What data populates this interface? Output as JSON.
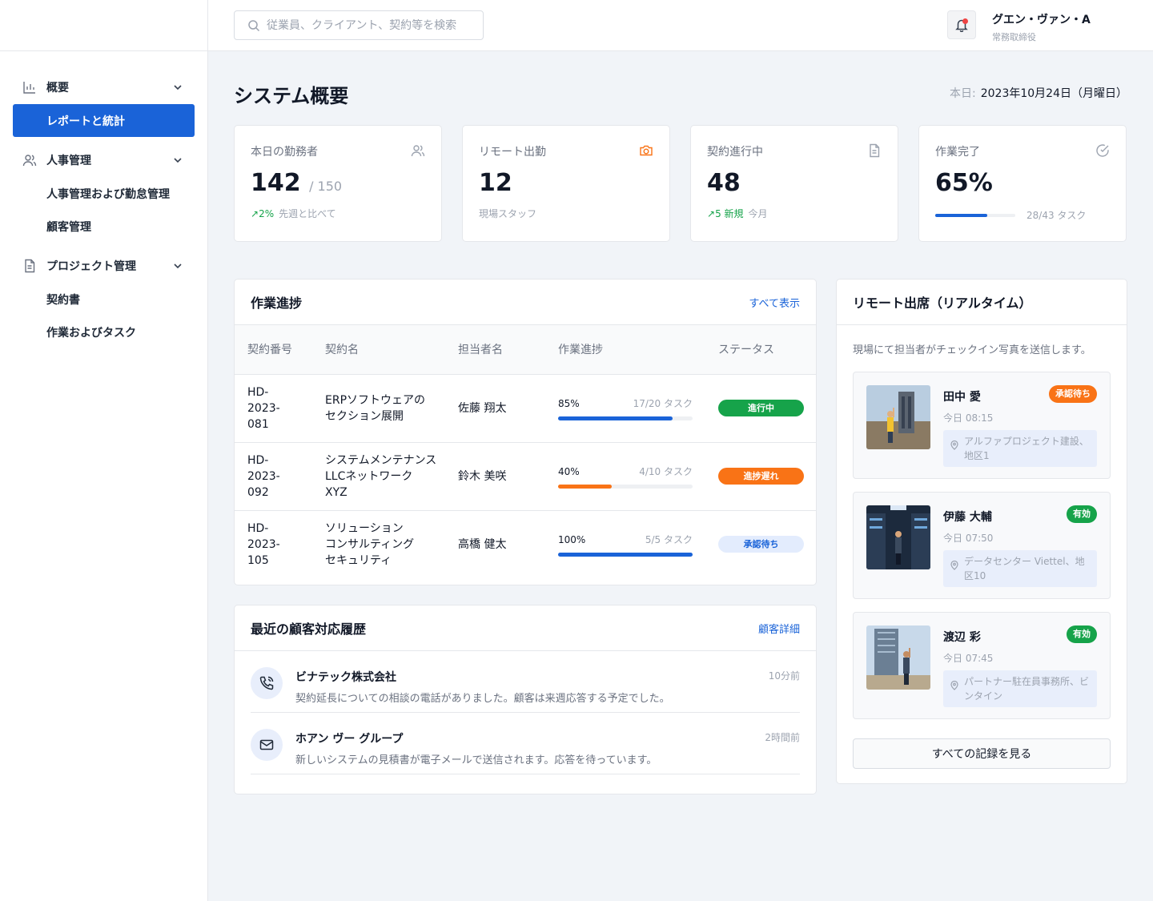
{
  "search": {
    "placeholder": "従業員、クライアント、契約等を検索"
  },
  "user": {
    "name": "グエン・ヴァン・A",
    "role": "常務取締役"
  },
  "sidebar": {
    "groups": [
      {
        "label": "概要",
        "icon": "bar-chart-icon",
        "items": [
          {
            "label": "レポートと統計",
            "active": true
          }
        ]
      },
      {
        "label": "人事管理",
        "icon": "users-icon",
        "items": [
          {
            "label": "人事管理および勤怠管理"
          },
          {
            "label": "顧客管理"
          }
        ]
      },
      {
        "label": "プロジェクト管理",
        "icon": "document-icon",
        "items": [
          {
            "label": "契約書"
          },
          {
            "label": "作業およびタスク"
          }
        ]
      }
    ]
  },
  "page": {
    "title": "システム概要",
    "today_label": "本日:",
    "today_value": "2023年10月24日（月曜日）"
  },
  "stats": [
    {
      "label": "本日の勤務者",
      "icon": "users-icon",
      "value": "142",
      "of": "/ 150",
      "trend": "2%",
      "foot": "先週と比べて"
    },
    {
      "label": "リモート出勤",
      "icon": "camera-icon",
      "value": "12",
      "foot": "現場スタッフ"
    },
    {
      "label": "契約進行中",
      "icon": "document-icon",
      "value": "48",
      "trend": "5 新規",
      "foot": "今月"
    },
    {
      "label": "作業完了",
      "icon": "check-circle-icon",
      "value": "65%",
      "progress": 0.65,
      "foot": "28/43 タスク"
    }
  ],
  "work_progress": {
    "title": "作業進捗",
    "link": "すべて表示",
    "headers": [
      "契約番号",
      "契約名",
      "担当者名",
      "作業進捗",
      "ステータス"
    ],
    "rows": [
      {
        "id": "HD-\n2023-\n081",
        "name": "ERPソフトウェアの\nセクション展開",
        "owner": "佐藤 翔太",
        "percent": "85%",
        "progress": 0.85,
        "tasks": "17/20 タスク",
        "status": "進行中",
        "status_bg": "#16a34a",
        "status_fg": "#ffffff",
        "bar_color": "#1a63d8"
      },
      {
        "id": "HD-\n2023-\n092",
        "name": "システムメンテナンス\nLLCネットワーク\nXYZ",
        "owner": "鈴木 美咲",
        "percent": "40%",
        "progress": 0.4,
        "tasks": "4/10 タスク",
        "status": "進捗遅れ",
        "status_bg": "#f97316",
        "status_fg": "#ffffff",
        "bar_color": "#f97316"
      },
      {
        "id": "HD-\n2023-\n105",
        "name": "ソリューション\nコンサルティング\nセキュリティ",
        "owner": "高橋 健太",
        "percent": "100%",
        "progress": 1.0,
        "tasks": "5/5 タスク",
        "status": "承認待ち",
        "status_bg": "#e3ecfd",
        "status_fg": "#1a63d8",
        "bar_color": "#1a63d8"
      }
    ]
  },
  "history": {
    "title": "最近の顧客対応履歴",
    "link": "顧客詳細",
    "items": [
      {
        "icon": "phone-icon",
        "title": "ビナテック株式会社",
        "desc": "契約延長についての相談の電話がありました。顧客は来週応答する予定でした。",
        "time": "10分前"
      },
      {
        "icon": "mail-icon",
        "title": "ホアン ヴー グループ",
        "desc": "新しいシステムの見積書が電子メールで送信されます。応答を待っています。",
        "time": "2時間前"
      }
    ]
  },
  "remote": {
    "title": "リモート出席（リアルタイム）",
    "intro": "現場にて担当者がチェックイン写真を送信します。",
    "items": [
      {
        "name": "田中 愛",
        "time": "今日 08:15",
        "badge": "承認待ち",
        "badge_color": "#f97316",
        "location": "アルファプロジェクト建設、地区1"
      },
      {
        "name": "伊藤 大輔",
        "time": "今日 07:50",
        "badge": "有効",
        "badge_color": "#16a34a",
        "location": "データセンター Viettel、地区10"
      },
      {
        "name": "渡辺 彩",
        "time": "今日 07:45",
        "badge": "有効",
        "badge_color": "#16a34a",
        "location": "パートナー駐在員事務所、ビンタイン"
      }
    ],
    "button": "すべての記録を見る"
  }
}
